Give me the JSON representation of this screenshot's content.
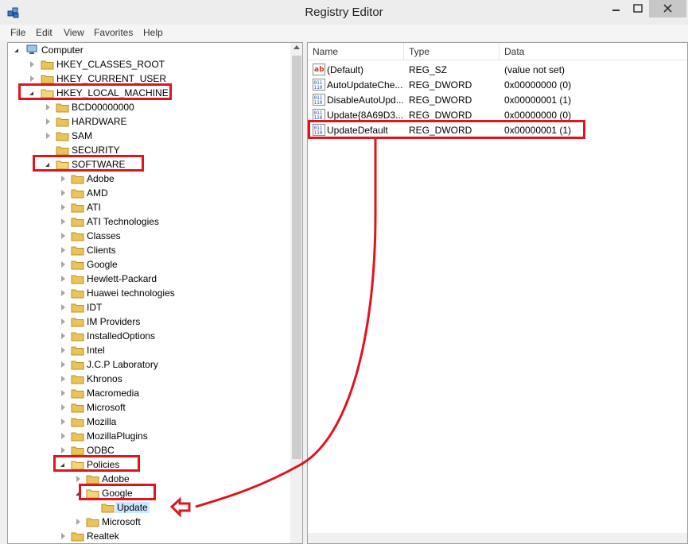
{
  "window": {
    "title": "Registry Editor"
  },
  "menu": [
    "File",
    "Edit",
    "View",
    "Favorites",
    "Help"
  ],
  "tree": {
    "root": "Computer",
    "hives": {
      "classes_root": "HKEY_CLASSES_ROOT",
      "current_user": "HKEY_CURRENT_USER",
      "local_machine": "HKEY_LOCAL_MACHINE"
    },
    "hklm_children": {
      "bcd": "BCD00000000",
      "hardware": "HARDWARE",
      "sam": "SAM",
      "security": "SECURITY",
      "software": "SOFTWARE"
    },
    "software_children": [
      "Adobe",
      "AMD",
      "ATI",
      "ATI Technologies",
      "Classes",
      "Clients",
      "Google",
      "Hewlett-Packard",
      "Huawei technologies",
      "IDT",
      "IM Providers",
      "InstalledOptions",
      "Intel",
      "J.C.P Laboratory",
      "Khronos",
      "Macromedia",
      "Microsoft",
      "Mozilla",
      "MozillaPlugins",
      "ODBC"
    ],
    "policies": "Policies",
    "policies_children": {
      "adobe": "Adobe",
      "google": "Google",
      "microsoft": "Microsoft"
    },
    "google_children": {
      "update": "Update"
    },
    "after_policies": "Realtek"
  },
  "values_list": {
    "columns": [
      "Name",
      "Type",
      "Data"
    ],
    "rows": [
      {
        "name": "(Default)",
        "type": "REG_SZ",
        "data": "(value not set)",
        "icon": "string-value-icon"
      },
      {
        "name": "AutoUpdateChe...",
        "type": "REG_DWORD",
        "data": "0x00000000 (0)",
        "icon": "dword-value-icon"
      },
      {
        "name": "DisableAutoUpd...",
        "type": "REG_DWORD",
        "data": "0x00000001 (1)",
        "icon": "dword-value-icon"
      },
      {
        "name": "Update{8A69D3...",
        "type": "REG_DWORD",
        "data": "0x00000000 (0)",
        "icon": "dword-value-icon"
      },
      {
        "name": "UpdateDefault",
        "type": "REG_DWORD",
        "data": "0x00000001 (1)",
        "icon": "dword-value-icon"
      }
    ]
  },
  "colors": {
    "annotation": "#e0141e",
    "folder": "#e8c45a",
    "selection": "#cce8ff"
  }
}
